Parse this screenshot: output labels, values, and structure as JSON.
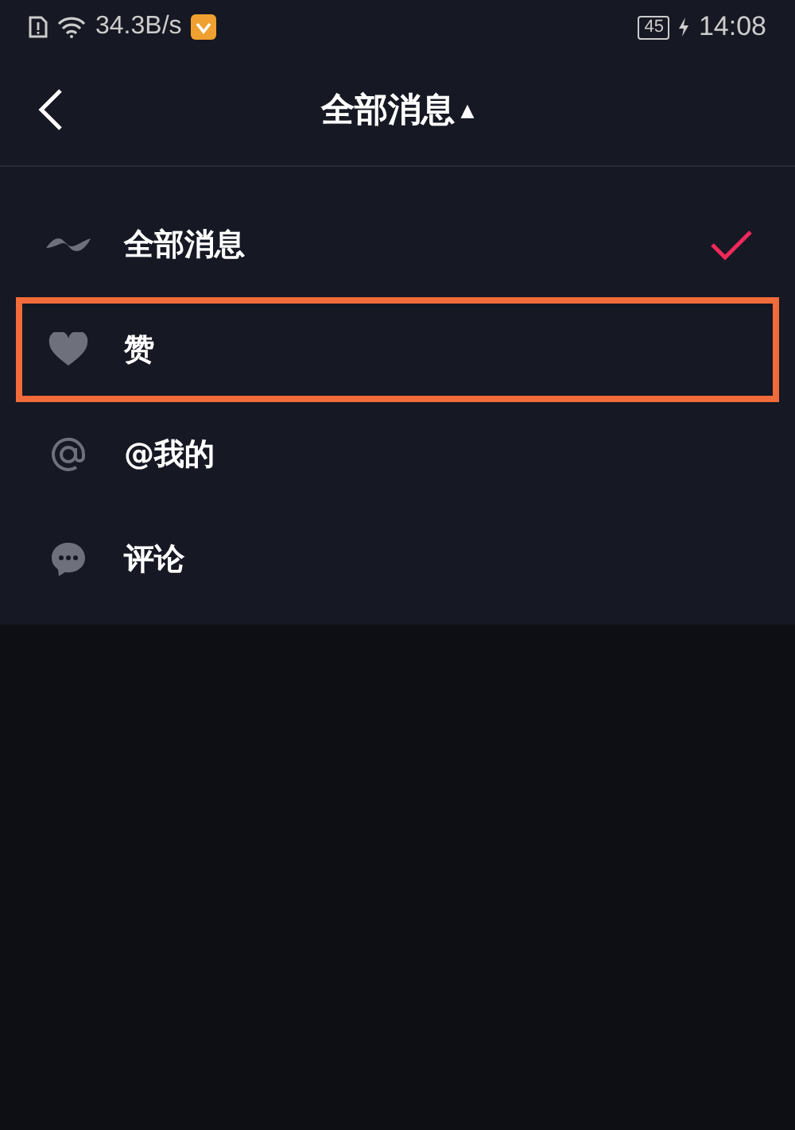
{
  "status_bar": {
    "network_speed": "34.3B/s",
    "battery": "45",
    "time": "14:08"
  },
  "header": {
    "title": "全部消息",
    "caret": "▲"
  },
  "menu": [
    {
      "kind": "all",
      "label": "全部消息",
      "selected": true,
      "highlighted": false
    },
    {
      "kind": "like",
      "label": "赞",
      "selected": false,
      "highlighted": true
    },
    {
      "kind": "mention",
      "label": "@我的",
      "selected": false,
      "highlighted": false
    },
    {
      "kind": "comment",
      "label": "评论",
      "selected": false,
      "highlighted": false
    }
  ]
}
